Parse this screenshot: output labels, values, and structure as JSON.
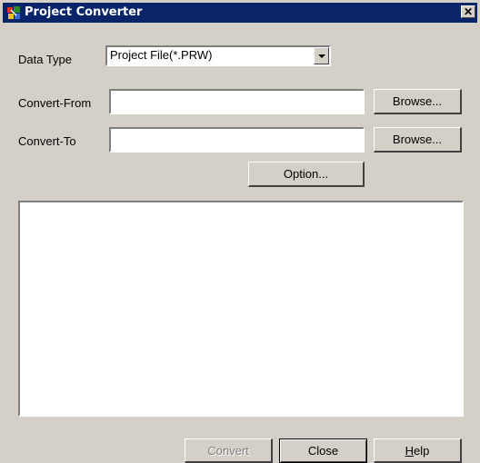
{
  "window": {
    "title": "Project Converter",
    "close_glyph": "✕"
  },
  "data_type": {
    "label": "Data Type",
    "value": "Project File(*.PRW)"
  },
  "convert_from": {
    "label": "Convert-From",
    "value": "",
    "browse_label": "Browse..."
  },
  "convert_to": {
    "label": "Convert-To",
    "value": "",
    "browse_label": "Browse..."
  },
  "option_label": "Option...",
  "footer": {
    "convert_label": "Convert",
    "close_label": "Close",
    "help_mnemonic": "H",
    "help_rest": "elp"
  },
  "icons": {
    "app": "project-converter-app-icon",
    "close": "close-icon",
    "dropdown": "chevron-down-icon"
  },
  "colors": {
    "titlebar": "#0a246a",
    "face": "#d4d0c8"
  }
}
